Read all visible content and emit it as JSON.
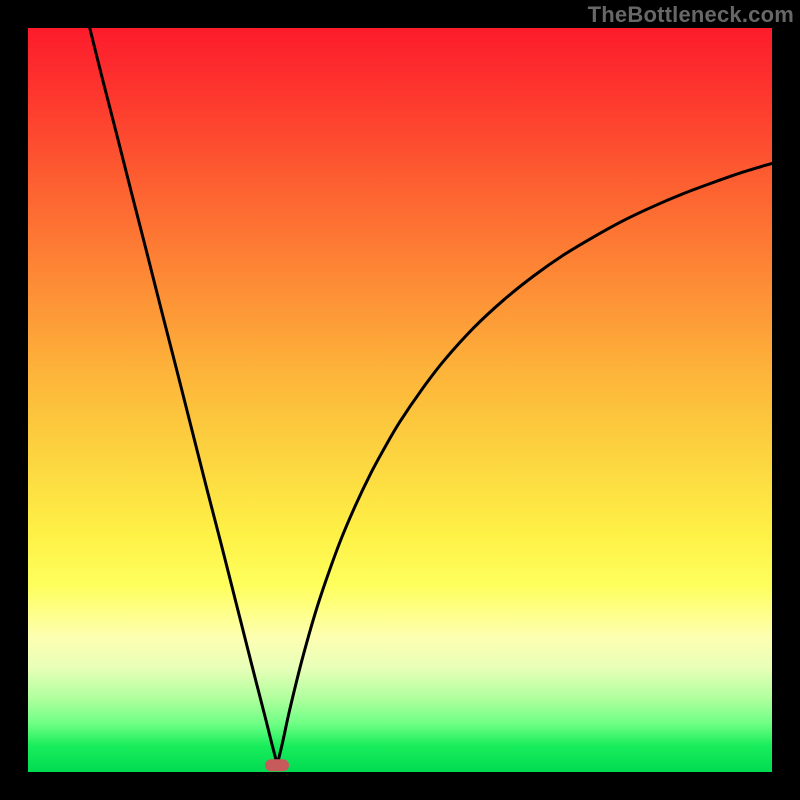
{
  "watermark": "TheBottleneck.com",
  "colors": {
    "frame": "#000000",
    "curve": "#000000",
    "marker": "#c75a5b",
    "gradient_top": "#fd1b2c",
    "gradient_bottom": "#00db51"
  },
  "chart_data": {
    "type": "line",
    "title": "",
    "xlabel": "",
    "ylabel": "",
    "xlim": [
      0,
      100
    ],
    "ylim": [
      0,
      100
    ],
    "annotations": [
      {
        "type": "marker",
        "x": 33.5,
        "y": 1.0,
        "shape": "pill",
        "color": "#c75a5b"
      }
    ],
    "series": [
      {
        "name": "left-branch",
        "x": [
          8.3,
          10,
          12,
          14,
          16,
          18,
          20,
          22,
          24,
          26,
          28,
          30,
          31,
          32,
          32.8,
          33.5
        ],
        "y": [
          100,
          93.2,
          85.4,
          77.5,
          69.7,
          61.8,
          54.0,
          46.1,
          38.2,
          30.5,
          22.6,
          14.7,
          10.8,
          6.9,
          3.7,
          1.0
        ]
      },
      {
        "name": "right-branch",
        "x": [
          33.5,
          34.2,
          35,
          36,
          37,
          38.5,
          40,
          42,
          44,
          46,
          48,
          50,
          53,
          56,
          60,
          64,
          68,
          72,
          76,
          80,
          84,
          88,
          92,
          96,
          100
        ],
        "y": [
          1.0,
          3.9,
          7.6,
          11.8,
          15.7,
          21.0,
          25.6,
          31.1,
          35.8,
          40.0,
          43.7,
          47.1,
          51.5,
          55.4,
          59.8,
          63.5,
          66.7,
          69.5,
          71.9,
          74.1,
          76.0,
          77.7,
          79.2,
          80.6,
          81.8
        ]
      }
    ]
  }
}
